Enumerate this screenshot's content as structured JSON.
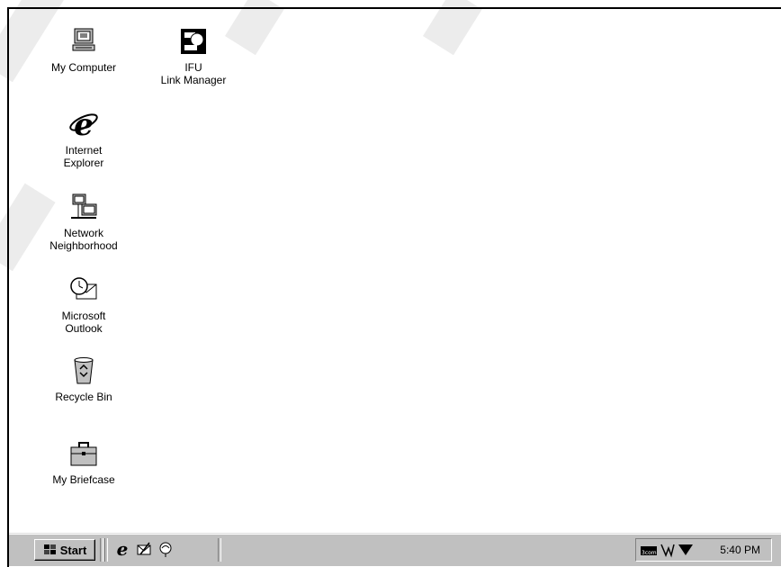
{
  "desktop": {
    "icons": [
      {
        "label": "My Computer",
        "icon": "my-computer-icon"
      },
      {
        "label": "IFU\nLink Manager",
        "icon": "link-manager-icon"
      },
      {
        "label": "Internet\nExplorer",
        "icon": "internet-explorer-icon"
      },
      {
        "label": "Network\nNeighborhood",
        "icon": "network-neighborhood-icon"
      },
      {
        "label": "Microsoft\nOutlook",
        "icon": "outlook-icon"
      },
      {
        "label": "Recycle Bin",
        "icon": "recycle-bin-icon"
      },
      {
        "label": "My Briefcase",
        "icon": "briefcase-icon"
      }
    ]
  },
  "taskbar": {
    "start_label": "Start",
    "quick_launch": [
      "internet-explorer-icon",
      "outlook-express-icon",
      "channels-icon"
    ],
    "tray_icons": [
      "3com-network-icon",
      "volume-icon",
      "mcafee-icon"
    ],
    "clock": "5:40 PM"
  },
  "colors": {
    "taskbar": "#c0c0c0",
    "desktop": "#ffffff"
  }
}
